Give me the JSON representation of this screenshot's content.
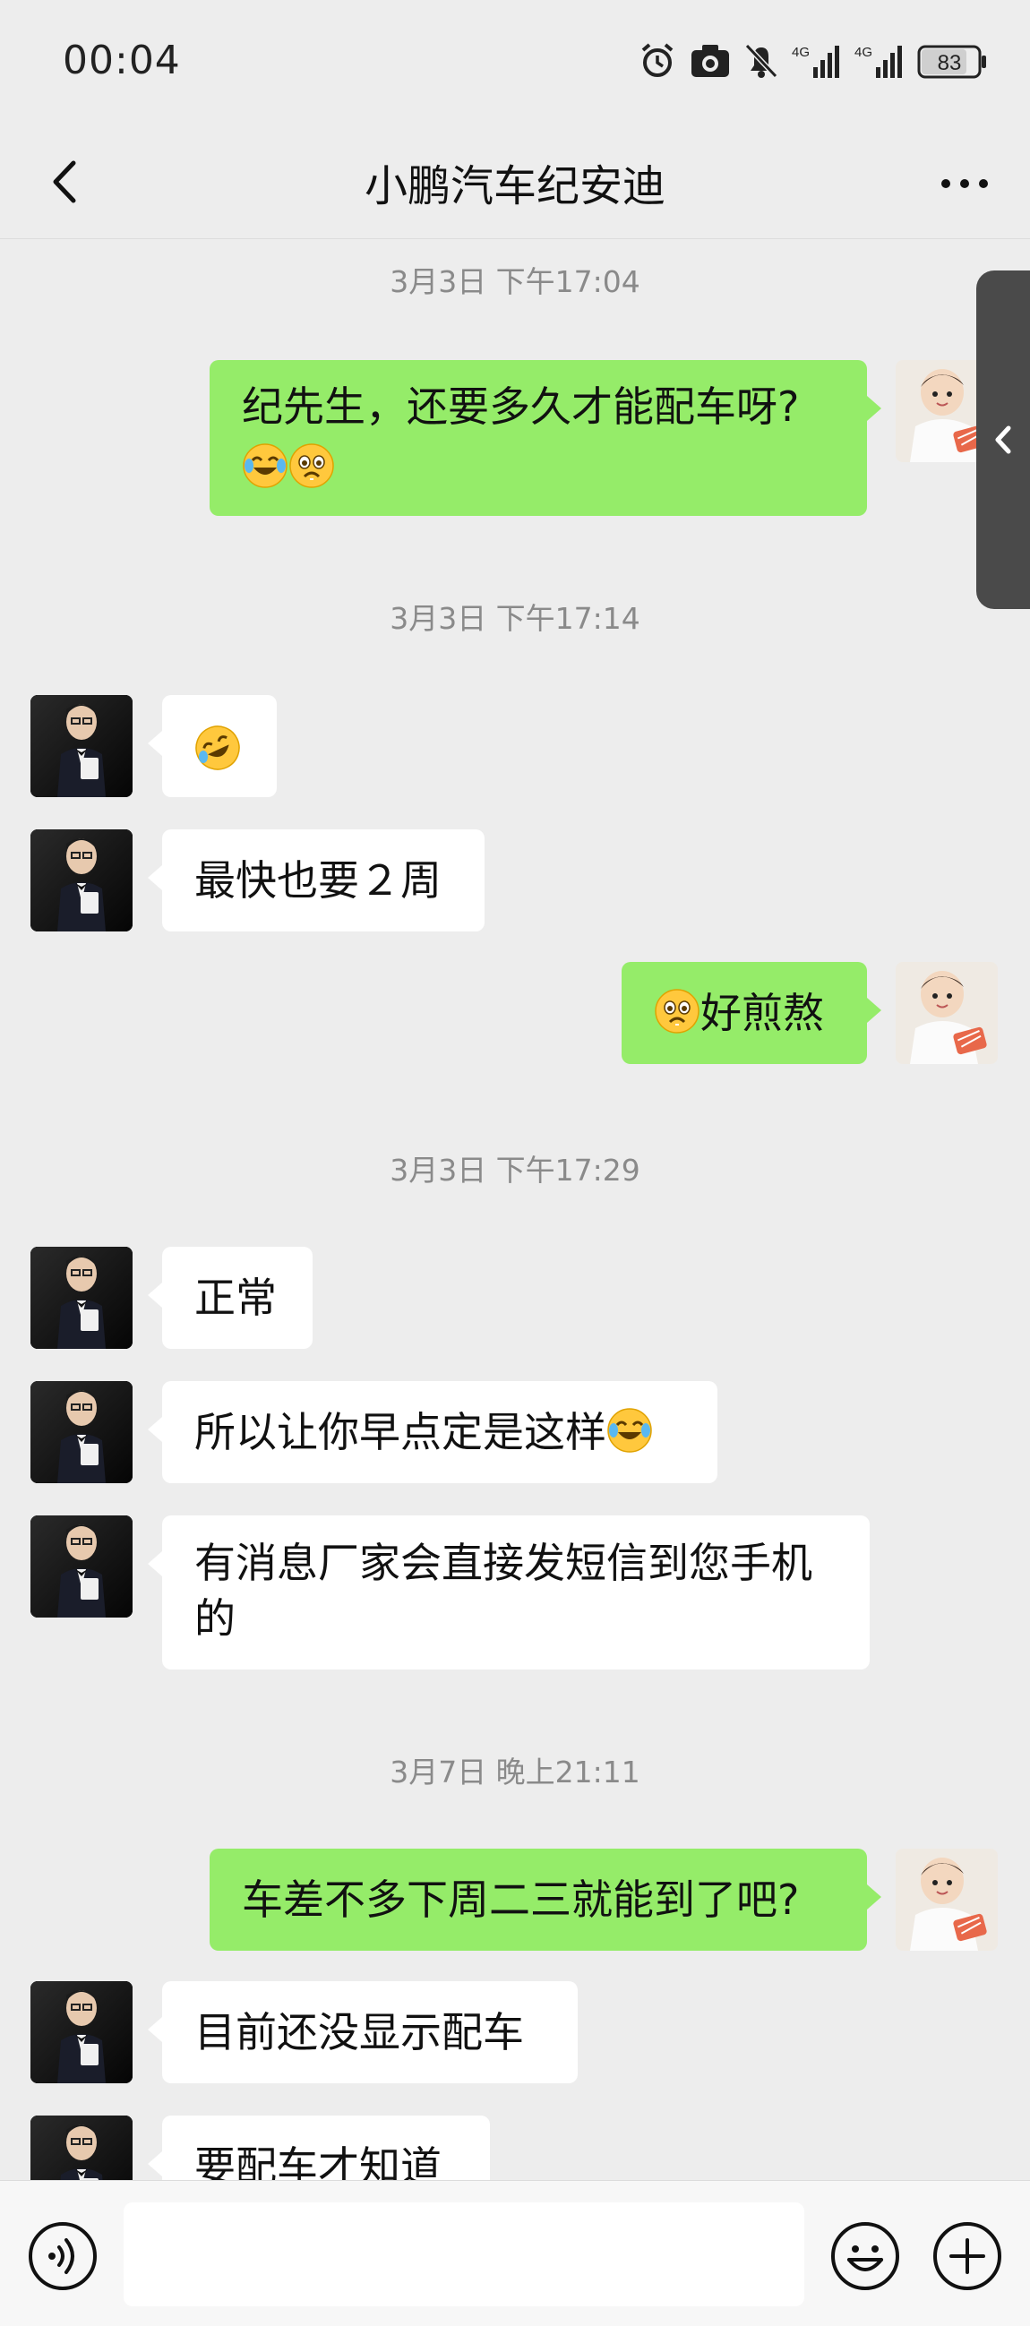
{
  "status_bar": {
    "time": "00:04",
    "battery": "83",
    "network_1": "4G",
    "network_2": "4G",
    "icons": [
      "alarm-icon",
      "camera-icon",
      "mute-bell-icon",
      "signal-icon",
      "signal-icon"
    ]
  },
  "header": {
    "title": "小鹏汽车纪安迪",
    "back_icon": "chevron-left-icon",
    "more_icon": "more-dots-icon"
  },
  "messages": [
    {
      "type": "timestamp",
      "text": "3月3日 下午17:04"
    },
    {
      "type": "me",
      "line1": "纪先生，还要多久才能配车呀?",
      "emoji": [
        "face-with-tears-of-joy",
        "face-holding-back-tears"
      ]
    },
    {
      "type": "timestamp",
      "text": "3月3日 下午17:14"
    },
    {
      "type": "them",
      "emoji": [
        "rolling-on-floor-laughing"
      ]
    },
    {
      "type": "them",
      "text": "最快也要２周"
    },
    {
      "type": "me",
      "text": "好煎熬",
      "emoji": [
        "face-holding-back-tears"
      ]
    },
    {
      "type": "timestamp",
      "text": "3月3日 下午17:29"
    },
    {
      "type": "them",
      "text": "正常"
    },
    {
      "type": "them",
      "text": "所以让你早点定是这样",
      "emoji": [
        "face-with-tears-of-joy"
      ]
    },
    {
      "type": "them",
      "line1": "有消息厂家会直接发短信到您手机",
      "line2": "的"
    },
    {
      "type": "timestamp",
      "text": "3月7日 晚上21:11"
    },
    {
      "type": "me",
      "text": "车差不多下周二三就能到了吧?"
    },
    {
      "type": "them",
      "text": "目前还没显示配车"
    },
    {
      "type": "them",
      "text": "要配车才知道"
    }
  ],
  "input_bar": {
    "voice_icon": "voice-icon",
    "emoji_icon": "smiley-icon",
    "plus_icon": "plus-circle-icon"
  },
  "colors": {
    "background": "#EDEDED",
    "my_bubble": "#95EC69",
    "their_bubble": "#FFFFFF",
    "timestamp_text": "#8A8A8A"
  }
}
